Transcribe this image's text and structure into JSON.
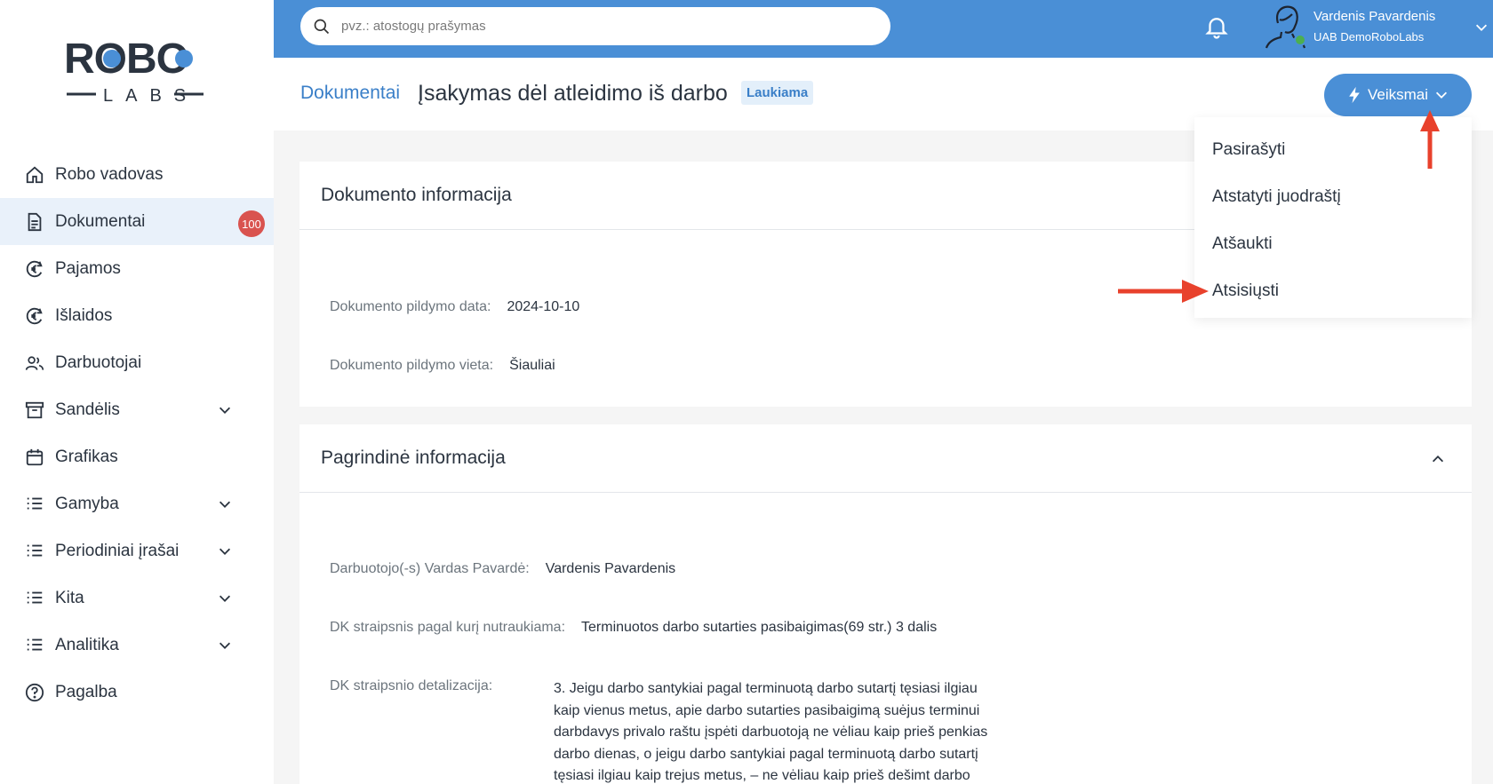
{
  "brand": {
    "name_top": "ROBO",
    "name_bottom": "LABS"
  },
  "sidebar": {
    "items": [
      {
        "label": "Robo vadovas",
        "icon": "home-icon"
      },
      {
        "label": "Dokumentai",
        "icon": "document-icon",
        "badge": "100"
      },
      {
        "label": "Pajamos",
        "icon": "euro-coin-icon"
      },
      {
        "label": "Išlaidos",
        "icon": "euro-coin-icon"
      },
      {
        "label": "Darbuotojai",
        "icon": "users-icon"
      },
      {
        "label": "Sandėlis",
        "icon": "archive-box-icon"
      },
      {
        "label": "Grafikas",
        "icon": "calendar-icon"
      },
      {
        "label": "Gamyba",
        "icon": "list-icon"
      },
      {
        "label": "Periodiniai įrašai",
        "icon": "list-icon"
      },
      {
        "label": "Kita",
        "icon": "list-icon"
      },
      {
        "label": "Analitika",
        "icon": "list-icon"
      },
      {
        "label": "Pagalba",
        "icon": "help-circle-icon"
      }
    ]
  },
  "topbar": {
    "search_placeholder": "pvz.: atostogų prašymas",
    "user_name": "Vardenis Pavardenis",
    "user_company": "UAB DemoRoboLabs"
  },
  "header": {
    "breadcrumb": "Dokumentai",
    "title": "Įsakymas dėl atleidimo iš darbo",
    "status": "Laukiama",
    "actions_label": "Veiksmai"
  },
  "dropdown": {
    "items": [
      "Pasirašyti",
      "Atstatyti juodraštį",
      "Atšaukti",
      "Atsisiųsti"
    ]
  },
  "doc_info": {
    "title": "Dokumento informacija",
    "date_label": "Dokumento pildymo data:",
    "date_value": "2024-10-10",
    "place_label": "Dokumento pildymo vieta:",
    "place_value": "Šiauliai"
  },
  "main_info": {
    "title": "Pagrindinė informacija",
    "employee_label": "Darbuotojo(-s) Vardas Pavardė:",
    "employee_value": "Vardenis Pavardenis",
    "article_label": "DK straipsnis pagal kurį nutraukiama:",
    "article_value": "Terminuotos darbo sutarties pasibaigimas(69 str.) 3 dalis",
    "detail_label": "DK straipsnio detalizacija:",
    "detail_value": "3. Jeigu darbo santykiai pagal terminuotą darbo sutartį tęsiasi ilgiau kaip vienus metus, apie darbo sutarties pasibaigimą suėjus terminui darbdavys privalo raštu įspėti darbuotoją ne vėliau kaip prieš penkias darbo dienas, o jeigu darbo santykiai pagal terminuotą darbo sutartį tęsiasi ilgiau kaip trejus metus, – ne vėliau kaip prieš dešimt darbo"
  },
  "colors": {
    "primary": "#4a8fd6",
    "badge": "#d9534f",
    "arrow": "#e8412c",
    "online": "#4caf50"
  }
}
